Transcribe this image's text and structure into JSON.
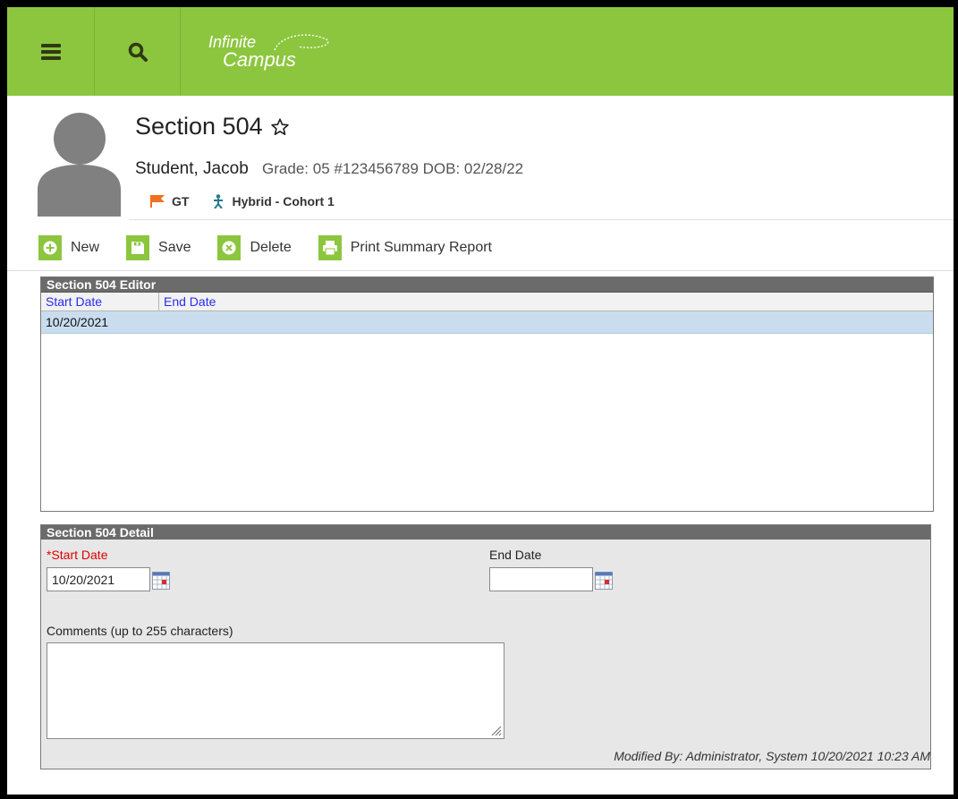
{
  "header": {
    "menu_icon": "hamburger-menu-icon",
    "search_icon": "search-icon",
    "logo_line1": "Infinite",
    "logo_line2": "Campus",
    "brand_color": "#8cc63f"
  },
  "page": {
    "title": "Section 504",
    "favorite_icon": "star-outline-icon"
  },
  "student": {
    "name": "Student, Jacob",
    "meta": "Grade: 05 #123456789 DOB: 02/28/22",
    "tags": [
      {
        "label": "GT",
        "icon": "flag-icon",
        "color": "#f07020"
      },
      {
        "label": "Hybrid - Cohort 1",
        "icon": "person-icon",
        "color": "#1f7a8c"
      }
    ]
  },
  "toolbar": {
    "new_label": "New",
    "save_label": "Save",
    "delete_label": "Delete",
    "print_label": "Print Summary Report"
  },
  "editor": {
    "title": "Section 504 Editor",
    "columns": [
      "Start Date",
      "End Date"
    ],
    "rows": [
      {
        "start_date": "10/20/2021",
        "end_date": ""
      }
    ]
  },
  "detail": {
    "title": "Section 504 Detail",
    "start_date_label": "*Start Date",
    "start_date_value": "10/20/2021",
    "end_date_label": "End Date",
    "end_date_value": "",
    "comments_label": "Comments (up to 255 characters)",
    "comments_value": "",
    "modified_by": "Modified By: Administrator, System 10/20/2021 10:23 AM"
  }
}
